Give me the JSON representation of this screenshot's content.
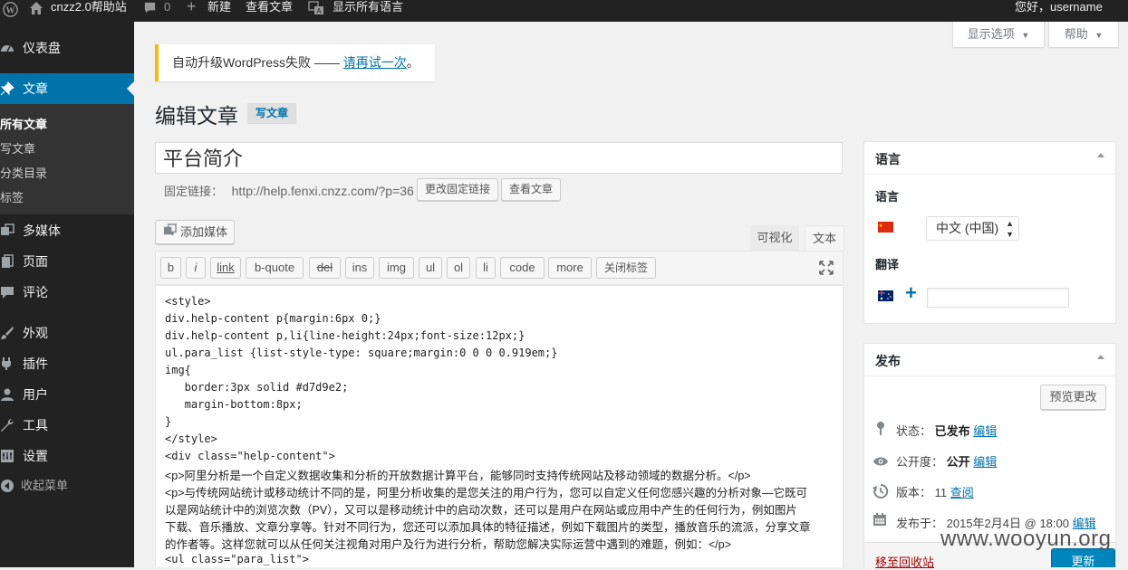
{
  "adminbar": {
    "wp_logo_icon": "wordpress-logo-icon",
    "site_name": "cnzz2.0帮助站",
    "comments_count": "0",
    "new_label": "新建",
    "view_post_label": "查看文章",
    "show_all_languages": "显示所有语言",
    "greeting": "您好，username"
  },
  "sidebar": {
    "items": [
      {
        "label": "仪表盘",
        "icon": "dashboard-icon"
      },
      {
        "label": "文章",
        "icon": "pin-icon"
      },
      {
        "label": "多媒体",
        "icon": "media-icon"
      },
      {
        "label": "页面",
        "icon": "page-icon"
      },
      {
        "label": "评论",
        "icon": "comment-icon"
      },
      {
        "label": "外观",
        "icon": "brush-icon"
      },
      {
        "label": "插件",
        "icon": "plugin-icon"
      },
      {
        "label": "用户",
        "icon": "user-icon"
      },
      {
        "label": "工具",
        "icon": "wrench-icon"
      },
      {
        "label": "设置",
        "icon": "settings-icon"
      },
      {
        "label": "收起菜单",
        "icon": "collapse-icon"
      }
    ],
    "submenu": [
      "所有文章",
      "写文章",
      "分类目录",
      "标签"
    ]
  },
  "screen_options": "显示选项",
  "help": "帮助",
  "notice": {
    "text": "自动升级WordPress失败 —— ",
    "link": "请再试一次",
    "suffix": "。"
  },
  "page_title": "编辑文章",
  "add_new": "写文章",
  "post_title": "平台简介",
  "permalink": {
    "label": "固定链接：",
    "url": "http://help.fenxi.cnzz.com/?p=36",
    "change_button": "更改固定链接",
    "view_button": "查看文章"
  },
  "add_media": "添加媒体",
  "editor_tabs": {
    "visual": "可视化",
    "text": "文本"
  },
  "quicktags": [
    "b",
    "i",
    "link",
    "b-quote",
    "del",
    "ins",
    "img",
    "ul",
    "ol",
    "li",
    "code",
    "more",
    "关闭标签"
  ],
  "content_code": [
    "<style>",
    "div.help-content p{margin:6px 0;}",
    "div.help-content p,li{line-height:24px;font-size:12px;}",
    "ul.para_list {list-style-type: square;margin:0 0 0 0.919em;}",
    "img{",
    "   border:3px solid #d7d9e2;",
    "   margin-bottom:8px;",
    "}",
    "</style>",
    "<div class=\"help-content\">"
  ],
  "content_text": [
    "<p>阿里分析是一个自定义数据收集和分析的开放数据计算平台，能够同时支持传统网站及移动领域的数据分析。</p>",
    "<p>与传统网站统计或移动统计不同的是，阿里分析收集的是您关注的用户行为，您可以自定义任何您感兴趣的分析对象—它既可",
    "以是网站统计中的浏览次数（PV），又可以是移动统计中的启动次数，还可以是用户在网站或应用中产生的任何行为，例如图片",
    "下载、音乐播放、文章分享等。针对不同行为，您还可以添加具体的特征描述，例如下载图片的类型，播放音乐的流派，分享文章",
    "的作者等。这样您就可以从任何关注视角对用户及行为进行分析，帮助您解决实际运营中遇到的难题，例如：</p>"
  ],
  "content_tail": "<ul class=\"para_list\">",
  "language_box": {
    "title": "语言",
    "language_label": "语言",
    "selected_language": "中文 (中国)",
    "translation_label": "翻译",
    "translation_value": ""
  },
  "publish_box": {
    "title": "发布",
    "preview_button": "预览更改",
    "status_label": "状态：",
    "status_value": "已发布",
    "visibility_label": "公开度：",
    "visibility_value": "公开",
    "revisions_label": "版本：",
    "revisions_count": "11",
    "revisions_link": "查阅",
    "published_label": "发布于：",
    "published_value": "2015年2月4日 @ 18:00",
    "edit_link": "编辑",
    "trash_link": "移至回收站",
    "update_button": "更新"
  },
  "watermark": "www.wooyun.org",
  "colors": {
    "admin_bar": "#222222",
    "menu_bg": "#222222",
    "active_menu": "#0073aa",
    "link": "#0073aa",
    "notice_warning": "#ffb900",
    "trash": "#a00000"
  }
}
